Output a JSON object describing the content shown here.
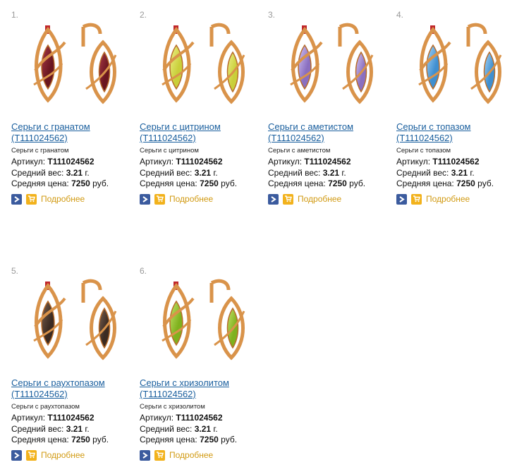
{
  "products": [
    {
      "num": "1.",
      "title_l1": "Серьги с гранатом",
      "title_l2": "(T111024562)",
      "sub": "Серьги с гранатом",
      "sku_label": "Артикул:",
      "sku": "T111024562",
      "weight_label": "Средний вес:",
      "weight": "3.21",
      "weight_unit": "г.",
      "price_label": "Средняя цена:",
      "price": "7250",
      "price_unit": "руб.",
      "more": "Подробнее",
      "stone_color": "#6a1620",
      "stone_light": "#a83a48",
      "icon": "garnet-earrings-image"
    },
    {
      "num": "2.",
      "title_l1": "Серьги с цитрином",
      "title_l2": "(T111024562)",
      "sub": "Серьги с цитрином",
      "sku_label": "Артикул:",
      "sku": "T111024562",
      "weight_label": "Средний вес:",
      "weight": "3.21",
      "weight_unit": "г.",
      "price_label": "Средняя цена:",
      "price": "7250",
      "price_unit": "руб.",
      "more": "Подробнее",
      "stone_color": "#c9cf3a",
      "stone_light": "#eef08a",
      "icon": "citrine-earrings-image"
    },
    {
      "num": "3.",
      "title_l1": "Серьги с аметистом",
      "title_l2": "(T111024562)",
      "sub": "Серьги с аметистом",
      "sku_label": "Артикул:",
      "sku": "T111024562",
      "weight_label": "Средний вес:",
      "weight": "3.21",
      "weight_unit": "г.",
      "price_label": "Средняя цена:",
      "price": "7250",
      "price_unit": "руб.",
      "more": "Подробнее",
      "stone_color": "#8a6fc0",
      "stone_light": "#d6c6f2",
      "icon": "amethyst-earrings-image"
    },
    {
      "num": "4.",
      "title_l1": "Серьги с топазом",
      "title_l2": "(T111024562)",
      "sub": "Серьги с топазом",
      "sku_label": "Артикул:",
      "sku": "T111024562",
      "weight_label": "Средний вес:",
      "weight": "3.21",
      "weight_unit": "г.",
      "price_label": "Средняя цена:",
      "price": "7250",
      "price_unit": "руб.",
      "more": "Подробнее",
      "stone_color": "#3f8fd0",
      "stone_light": "#a9d6f6",
      "icon": "topaz-earrings-image"
    },
    {
      "num": "5.",
      "title_l1": "Серьги с раухтопазом",
      "title_l2": "(T111024562)",
      "sub": "Серьги с раухтопазом",
      "sku_label": "Артикул:",
      "sku": "T111024562",
      "weight_label": "Средний вес:",
      "weight": "3.21",
      "weight_unit": "г.",
      "price_label": "Средняя цена:",
      "price": "7250",
      "price_unit": "руб.",
      "more": "Подробнее",
      "stone_color": "#3b2b22",
      "stone_light": "#7a6150",
      "icon": "smoky-quartz-earrings-image"
    },
    {
      "num": "6.",
      "title_l1": "Серьги с хризолитом",
      "title_l2": "(T111024562)",
      "sub": "Серьги с хризолитом",
      "sku_label": "Артикул:",
      "sku": "T111024562",
      "weight_label": "Средний вес:",
      "weight": "3.21",
      "weight_unit": "г.",
      "price_label": "Средняя цена:",
      "price": "7250",
      "price_unit": "руб.",
      "more": "Подробнее",
      "stone_color": "#7fb11e",
      "stone_light": "#c6e36a",
      "icon": "chrysolite-earrings-image"
    }
  ],
  "colors": {
    "link": "#1a5f9e",
    "gold": "#d9934a",
    "gold_dark": "#b86c2a",
    "more": "#d19a12"
  }
}
